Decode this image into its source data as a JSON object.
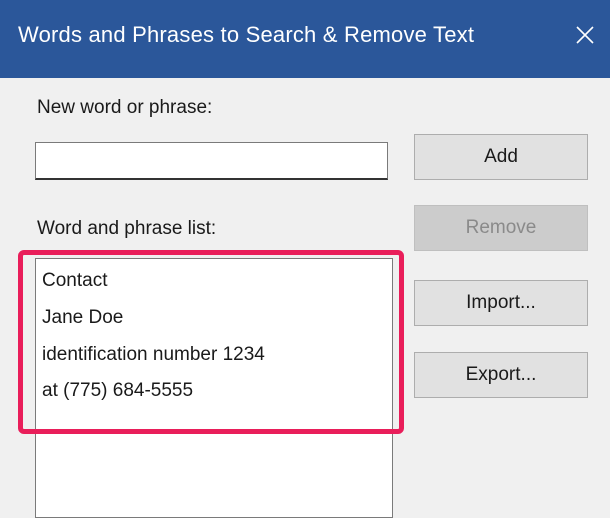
{
  "dialog": {
    "title": "Words and Phrases to Search & Remove Text"
  },
  "new_word": {
    "label": "New word or phrase:",
    "value": ""
  },
  "list": {
    "label": "Word and phrase list:",
    "items": [
      "Contact",
      "Jane Doe",
      "identification number 1234",
      "at (775) 684-5555"
    ]
  },
  "buttons": {
    "add": "Add",
    "remove": "Remove",
    "import": "Import...",
    "export": "Export..."
  },
  "colors": {
    "titlebar": "#2b579a",
    "highlight": "#e91e5a"
  },
  "icons": {
    "close": "close-icon"
  }
}
